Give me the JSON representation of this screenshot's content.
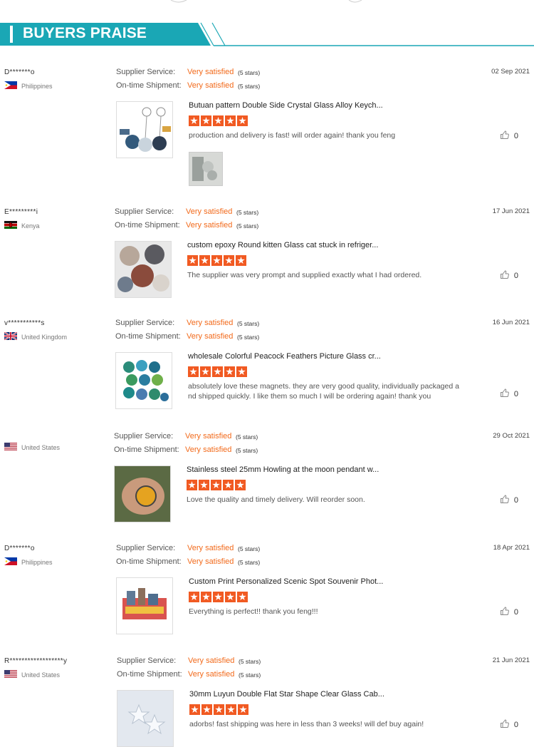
{
  "header": {
    "title": "BUYERS PRAISE"
  },
  "labels": {
    "supplier": "Supplier Service:",
    "shipment": "On-time Shipment:"
  },
  "reviews": [
    {
      "reviewer": "D*******o",
      "country": "Philippines",
      "flag": "philippines-flag-icon",
      "supplier": "Very satisfied",
      "supplier_stars": "(5 stars)",
      "shipment": "Very satisfied",
      "shipment_stars": "(5 stars)",
      "date": "02 Sep 2021",
      "product": "Butuan pattern Double Side Crystal Glass Alloy Keych...",
      "rating": 5,
      "comment": "production and delivery is fast! will order again! thank you feng",
      "likes": "0"
    },
    {
      "reviewer": "E*********i",
      "country": "Kenya",
      "flag": "kenya-flag-icon",
      "supplier": "Very satisfied",
      "supplier_stars": "(5 stars)",
      "shipment": "Very satisfied",
      "shipment_stars": "(5 stars)",
      "date": "17 Jun 2021",
      "product": "custom epoxy Round kitten Glass cat stuck in refriger...",
      "rating": 5,
      "comment": "The supplier was very prompt and supplied exactly what I had ordered.",
      "likes": "0"
    },
    {
      "reviewer": "v***********s",
      "country": "United Kingdom",
      "flag": "uk-flag-icon",
      "supplier": "Very satisfied",
      "supplier_stars": "(5 stars)",
      "shipment": "Very satisfied",
      "shipment_stars": "(5 stars)",
      "date": "16 Jun 2021",
      "product": "wholesale Colorful Peacock Feathers Picture Glass cr...",
      "rating": 5,
      "comment": "absolutely love these magnets. they are very good quality, individually packaged a nd shipped quickly. I like them so much I will be ordering again! thank you",
      "likes": "0"
    },
    {
      "reviewer": "",
      "country": "United States",
      "flag": "us-flag-icon",
      "supplier": "Very satisfied",
      "supplier_stars": "(5 stars)",
      "shipment": "Very satisfied",
      "shipment_stars": "(5 stars)",
      "date": "29 Oct 2021",
      "product": "Stainless steel 25mm Howling at the moon pendant w...",
      "rating": 5,
      "comment": "Love the quality and timely delivery. Will reorder soon.",
      "likes": "0"
    },
    {
      "reviewer": "D*******o",
      "country": "Philippines",
      "flag": "philippines-flag-icon",
      "supplier": "Very satisfied",
      "supplier_stars": "(5 stars)",
      "shipment": "Very satisfied",
      "shipment_stars": "(5 stars)",
      "date": "18 Apr 2021",
      "product": "Custom Print Personalized Scenic Spot Souvenir Phot...",
      "rating": 5,
      "comment": "Everything is perfect!! thank you feng!!!",
      "likes": "0"
    },
    {
      "reviewer": "R******************y",
      "country": "United States",
      "flag": "us-flag-icon",
      "supplier": "Very satisfied",
      "supplier_stars": "(5 stars)",
      "shipment": "Very satisfied",
      "shipment_stars": "(5 stars)",
      "date": "21 Jun 2021",
      "product": "30mm Luyun Double Flat Star Shape Clear Glass Cab...",
      "rating": 5,
      "comment": "adorbs! fast shipping was here in less than 3 weeks! will def buy again!",
      "likes": "0"
    }
  ],
  "colors": {
    "banner": "#1aa7b5",
    "accent": "#f26a1b",
    "star": "#f15a22"
  }
}
